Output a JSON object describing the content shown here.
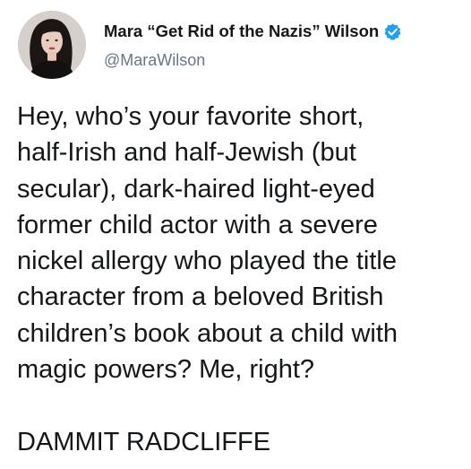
{
  "author": {
    "display_name": "Mara “Get Rid of the Nazis” Wilson",
    "handle": "@MaraWilson",
    "verified": true,
    "verified_icon": "verified-badge-icon",
    "avatar_icon": "profile-photo"
  },
  "tweet": {
    "paragraphs": [
      "Hey, who’s your favorite short,\nhalf-Irish and half-Jewish (but\nsecular), dark-haired light-eyed\nformer child actor with a severe\nnickel allergy who played the title\ncharacter from a beloved British\nchildren’s book about a child with\nmagic powers? Me, right?",
      "DAMMIT RADCLIFFE"
    ]
  },
  "colors": {
    "text": "#14171a",
    "secondary_text": "#657786",
    "verified_blue": "#1da1f2",
    "background": "#ffffff"
  }
}
